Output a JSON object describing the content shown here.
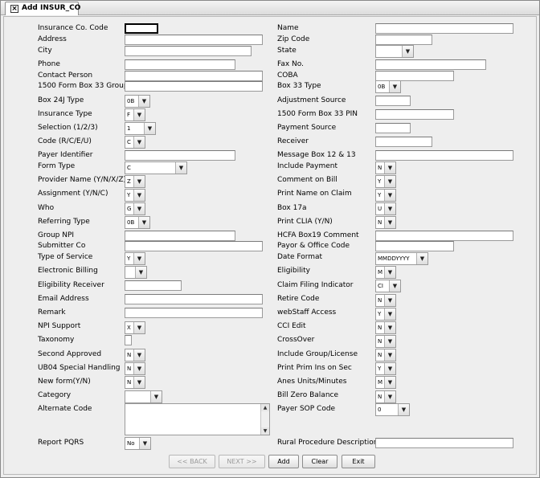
{
  "window": {
    "title": "Add INSUR_CO"
  },
  "left": [
    {
      "label": "Insurance Co. Code",
      "type": "text",
      "value": ""
    },
    {
      "label": "Address",
      "type": "text",
      "value": ""
    },
    {
      "label": "City",
      "type": "text",
      "value": ""
    },
    {
      "label": "Phone",
      "type": "text",
      "value": ""
    },
    {
      "label": "Contact Person",
      "type": "text",
      "value": ""
    },
    {
      "label": "1500 Form Box 33 Group",
      "type": "text",
      "value": ""
    },
    {
      "label": "Box 24J Type",
      "type": "combo",
      "value": "0B"
    },
    {
      "label": "Insurance Type",
      "type": "combo",
      "value": "F"
    },
    {
      "label": "Selection (1/2/3)",
      "type": "combo",
      "value": "1"
    },
    {
      "label": "Code (R/C/E/U)",
      "type": "combo",
      "value": "C"
    },
    {
      "label": "Payer Identifier",
      "type": "text",
      "value": ""
    },
    {
      "label": "Form Type",
      "type": "combo",
      "value": "C"
    },
    {
      "label": "Provider Name (Y/N/X/Z)",
      "type": "combo",
      "value": "Z"
    },
    {
      "label": "Assignment (Y/N/C)",
      "type": "combo",
      "value": "Y"
    },
    {
      "label": "Who",
      "type": "combo",
      "value": "G"
    },
    {
      "label": "Referring Type",
      "type": "combo",
      "value": "0B"
    },
    {
      "label": "Group NPI",
      "type": "text",
      "value": ""
    },
    {
      "label": "Submitter Co",
      "type": "text",
      "value": ""
    },
    {
      "label": "Type of Service",
      "type": "combo",
      "value": "Y"
    },
    {
      "label": "Electronic Billing",
      "type": "combo",
      "value": ""
    },
    {
      "label": "Eligibility Receiver",
      "type": "text",
      "value": ""
    },
    {
      "label": "Email Address",
      "type": "text",
      "value": ""
    },
    {
      "label": "Remark",
      "type": "text",
      "value": ""
    },
    {
      "label": "NPI Support",
      "type": "combo",
      "value": "X"
    },
    {
      "label": "Taxonomy",
      "type": "text",
      "value": ""
    },
    {
      "label": "Second Approved",
      "type": "combo",
      "value": "N"
    },
    {
      "label": "UB04 Special Handling",
      "type": "combo",
      "value": "N"
    },
    {
      "label": "New form(Y/N)",
      "type": "combo",
      "value": "N"
    },
    {
      "label": "Category",
      "type": "combo",
      "value": ""
    },
    {
      "label": "Alternate Code",
      "type": "textarea",
      "value": ""
    },
    {
      "label": "Report PQRS",
      "type": "combo",
      "value": "No"
    }
  ],
  "right": [
    {
      "label": "Name",
      "type": "text",
      "value": ""
    },
    {
      "label": "Zip Code",
      "type": "text",
      "value": ""
    },
    {
      "label": "State",
      "type": "combo",
      "value": ""
    },
    {
      "label": "Fax No.",
      "type": "text",
      "value": ""
    },
    {
      "label": "COBA",
      "type": "text",
      "value": ""
    },
    {
      "label": "Box 33 Type",
      "type": "combo",
      "value": "0B"
    },
    {
      "label": "Adjustment Source",
      "type": "text",
      "value": ""
    },
    {
      "label": "1500 Form Box 33 PIN",
      "type": "text",
      "value": ""
    },
    {
      "label": "Payment Source",
      "type": "text",
      "value": ""
    },
    {
      "label": "Receiver",
      "type": "text",
      "value": ""
    },
    {
      "label": "Message Box 12 & 13",
      "type": "text",
      "value": ""
    },
    {
      "label": "Include Payment",
      "type": "combo",
      "value": "N"
    },
    {
      "label": "Comment on Bill",
      "type": "combo",
      "value": "Y"
    },
    {
      "label": "Print Name on Claim",
      "type": "combo",
      "value": "Y"
    },
    {
      "label": "Box 17a",
      "type": "combo",
      "value": "U"
    },
    {
      "label": "Print CLIA (Y/N)",
      "type": "combo",
      "value": "N"
    },
    {
      "label": "HCFA Box19 Comment",
      "type": "text",
      "value": ""
    },
    {
      "label": "Payor & Office Code",
      "type": "text",
      "value": ""
    },
    {
      "label": "Date Format",
      "type": "combo",
      "value": "MMDDYYYY"
    },
    {
      "label": "Eligibility",
      "type": "combo",
      "value": "M"
    },
    {
      "label": "Claim Filing Indicator",
      "type": "combo",
      "value": "CI"
    },
    {
      "label": "Retire Code",
      "type": "combo",
      "value": "N"
    },
    {
      "label": "webStaff Access",
      "type": "combo",
      "value": "Y"
    },
    {
      "label": "CCI Edit",
      "type": "combo",
      "value": "N"
    },
    {
      "label": "CrossOver",
      "type": "combo",
      "value": "N"
    },
    {
      "label": "Include Group/License",
      "type": "combo",
      "value": "N"
    },
    {
      "label": "Print Prim Ins on Sec",
      "type": "combo",
      "value": "Y"
    },
    {
      "label": "Anes Units/Minutes",
      "type": "combo",
      "value": "M"
    },
    {
      "label": "Bill Zero Balance",
      "type": "combo",
      "value": "N"
    },
    {
      "label": "Payer SOP Code",
      "type": "combo",
      "value": "0"
    },
    {
      "label": "Rural Procedure Description",
      "type": "text",
      "value": ""
    }
  ],
  "buttons": {
    "back": "<< BACK",
    "next": "NEXT >>",
    "add": "Add",
    "clear": "Clear",
    "exit": "Exit"
  }
}
